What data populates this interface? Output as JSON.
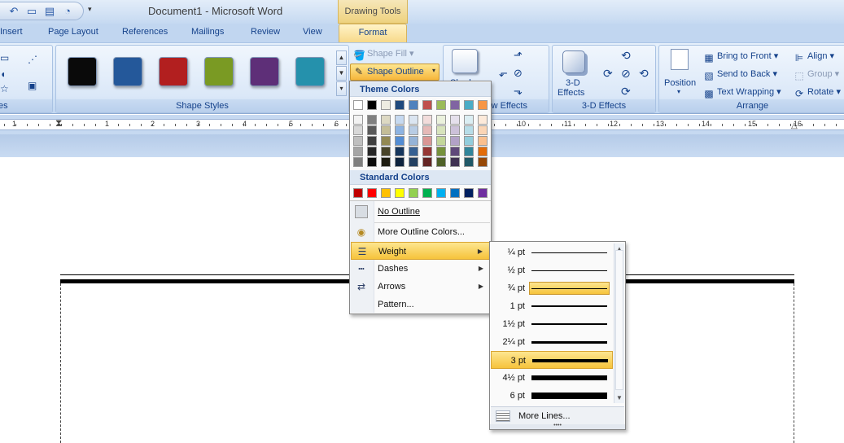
{
  "titlebar": {
    "document_title": "Document1 - Microsoft Word",
    "contextual_tab_group": "Drawing Tools",
    "qat_icons": [
      "undo-icon",
      "open-icon",
      "print-icon",
      "print-preview-icon"
    ],
    "qat_more": "▾"
  },
  "tabs": {
    "insert": "Insert",
    "page_layout": "Page Layout",
    "references": "References",
    "mailings": "Mailings",
    "review": "Review",
    "view": "View",
    "format": "Format"
  },
  "ribbon": {
    "insert_shapes_label": "es",
    "shape_styles_label": "Shape Styles",
    "shape_style_colors": [
      "#0a0a0a",
      "#24589a",
      "#b21f1f",
      "#7a9a23",
      "#5e2f78",
      "#2591ac"
    ],
    "shape_fill": "Shape Fill",
    "shape_outline": "Shape Outline",
    "shadow_effects_label": "w Effects",
    "shadow_effects_button": "Shadow",
    "threed_button_line1": "3-D",
    "threed_button_line2": "Effects",
    "threed_effects_label": "3-D Effects",
    "position": "Position",
    "bring_to_front": "Bring to Front",
    "send_to_back": "Send to Back",
    "text_wrapping": "Text Wrapping",
    "align": "Align",
    "group": "Group",
    "rotate": "Rotate",
    "arrange_label": "Arrange"
  },
  "ruler": {
    "numbers": [
      "1",
      "1",
      "2",
      "3",
      "4",
      "5",
      "6",
      "10",
      "11",
      "12",
      "13",
      "14",
      "15",
      "16"
    ]
  },
  "outline_menu": {
    "theme_colors_header": "Theme Colors",
    "theme_top_row": [
      "#ffffff",
      "#000000",
      "#eeece1",
      "#1f497d",
      "#4f81bd",
      "#c0504d",
      "#9bbb59",
      "#8064a2",
      "#4bacc6",
      "#f79646"
    ],
    "theme_shades": [
      [
        "#f2f2f2",
        "#7f7f7f",
        "#ddd9c3",
        "#c6d9f0",
        "#dbe5f1",
        "#f2dcdb",
        "#ebf1dd",
        "#e5e0ec",
        "#dbeef3",
        "#fdeada"
      ],
      [
        "#d8d8d8",
        "#595959",
        "#c4bd97",
        "#8db3e2",
        "#b8cce4",
        "#e5b9b7",
        "#d7e3bc",
        "#ccc1d9",
        "#b7dde8",
        "#fbd5b5"
      ],
      [
        "#bfbfbf",
        "#3f3f3f",
        "#938953",
        "#548dd4",
        "#95b3d7",
        "#d99694",
        "#c3d69b",
        "#b2a2c7",
        "#92cddc",
        "#fac08f"
      ],
      [
        "#a5a5a5",
        "#262626",
        "#494429",
        "#17365d",
        "#366092",
        "#953734",
        "#76923c",
        "#5f497a",
        "#31859b",
        "#e36c09"
      ],
      [
        "#7f7f7f",
        "#0c0c0c",
        "#1d1b10",
        "#0f243e",
        "#244061",
        "#632423",
        "#4f6128",
        "#3f3151",
        "#205867",
        "#974806"
      ]
    ],
    "standard_colors_header": "Standard Colors",
    "standard_colors": [
      "#c00000",
      "#ff0000",
      "#ffc000",
      "#ffff00",
      "#92d050",
      "#00b050",
      "#00b0f0",
      "#0070c0",
      "#002060",
      "#7030a0"
    ],
    "no_outline": "No Outline",
    "more_outline_colors": "More Outline Colors...",
    "weight": "Weight",
    "dashes": "Dashes",
    "arrows": "Arrows",
    "pattern": "Pattern..."
  },
  "weight_menu": {
    "items": [
      "¼ pt",
      "½ pt",
      "¾ pt",
      "1 pt",
      "1½ pt",
      "2¼ pt",
      "3 pt",
      "4½ pt",
      "6 pt"
    ],
    "highlighted_line_item": "¾ pt",
    "selected_item": "3 pt",
    "more_lines": "More Lines..."
  }
}
